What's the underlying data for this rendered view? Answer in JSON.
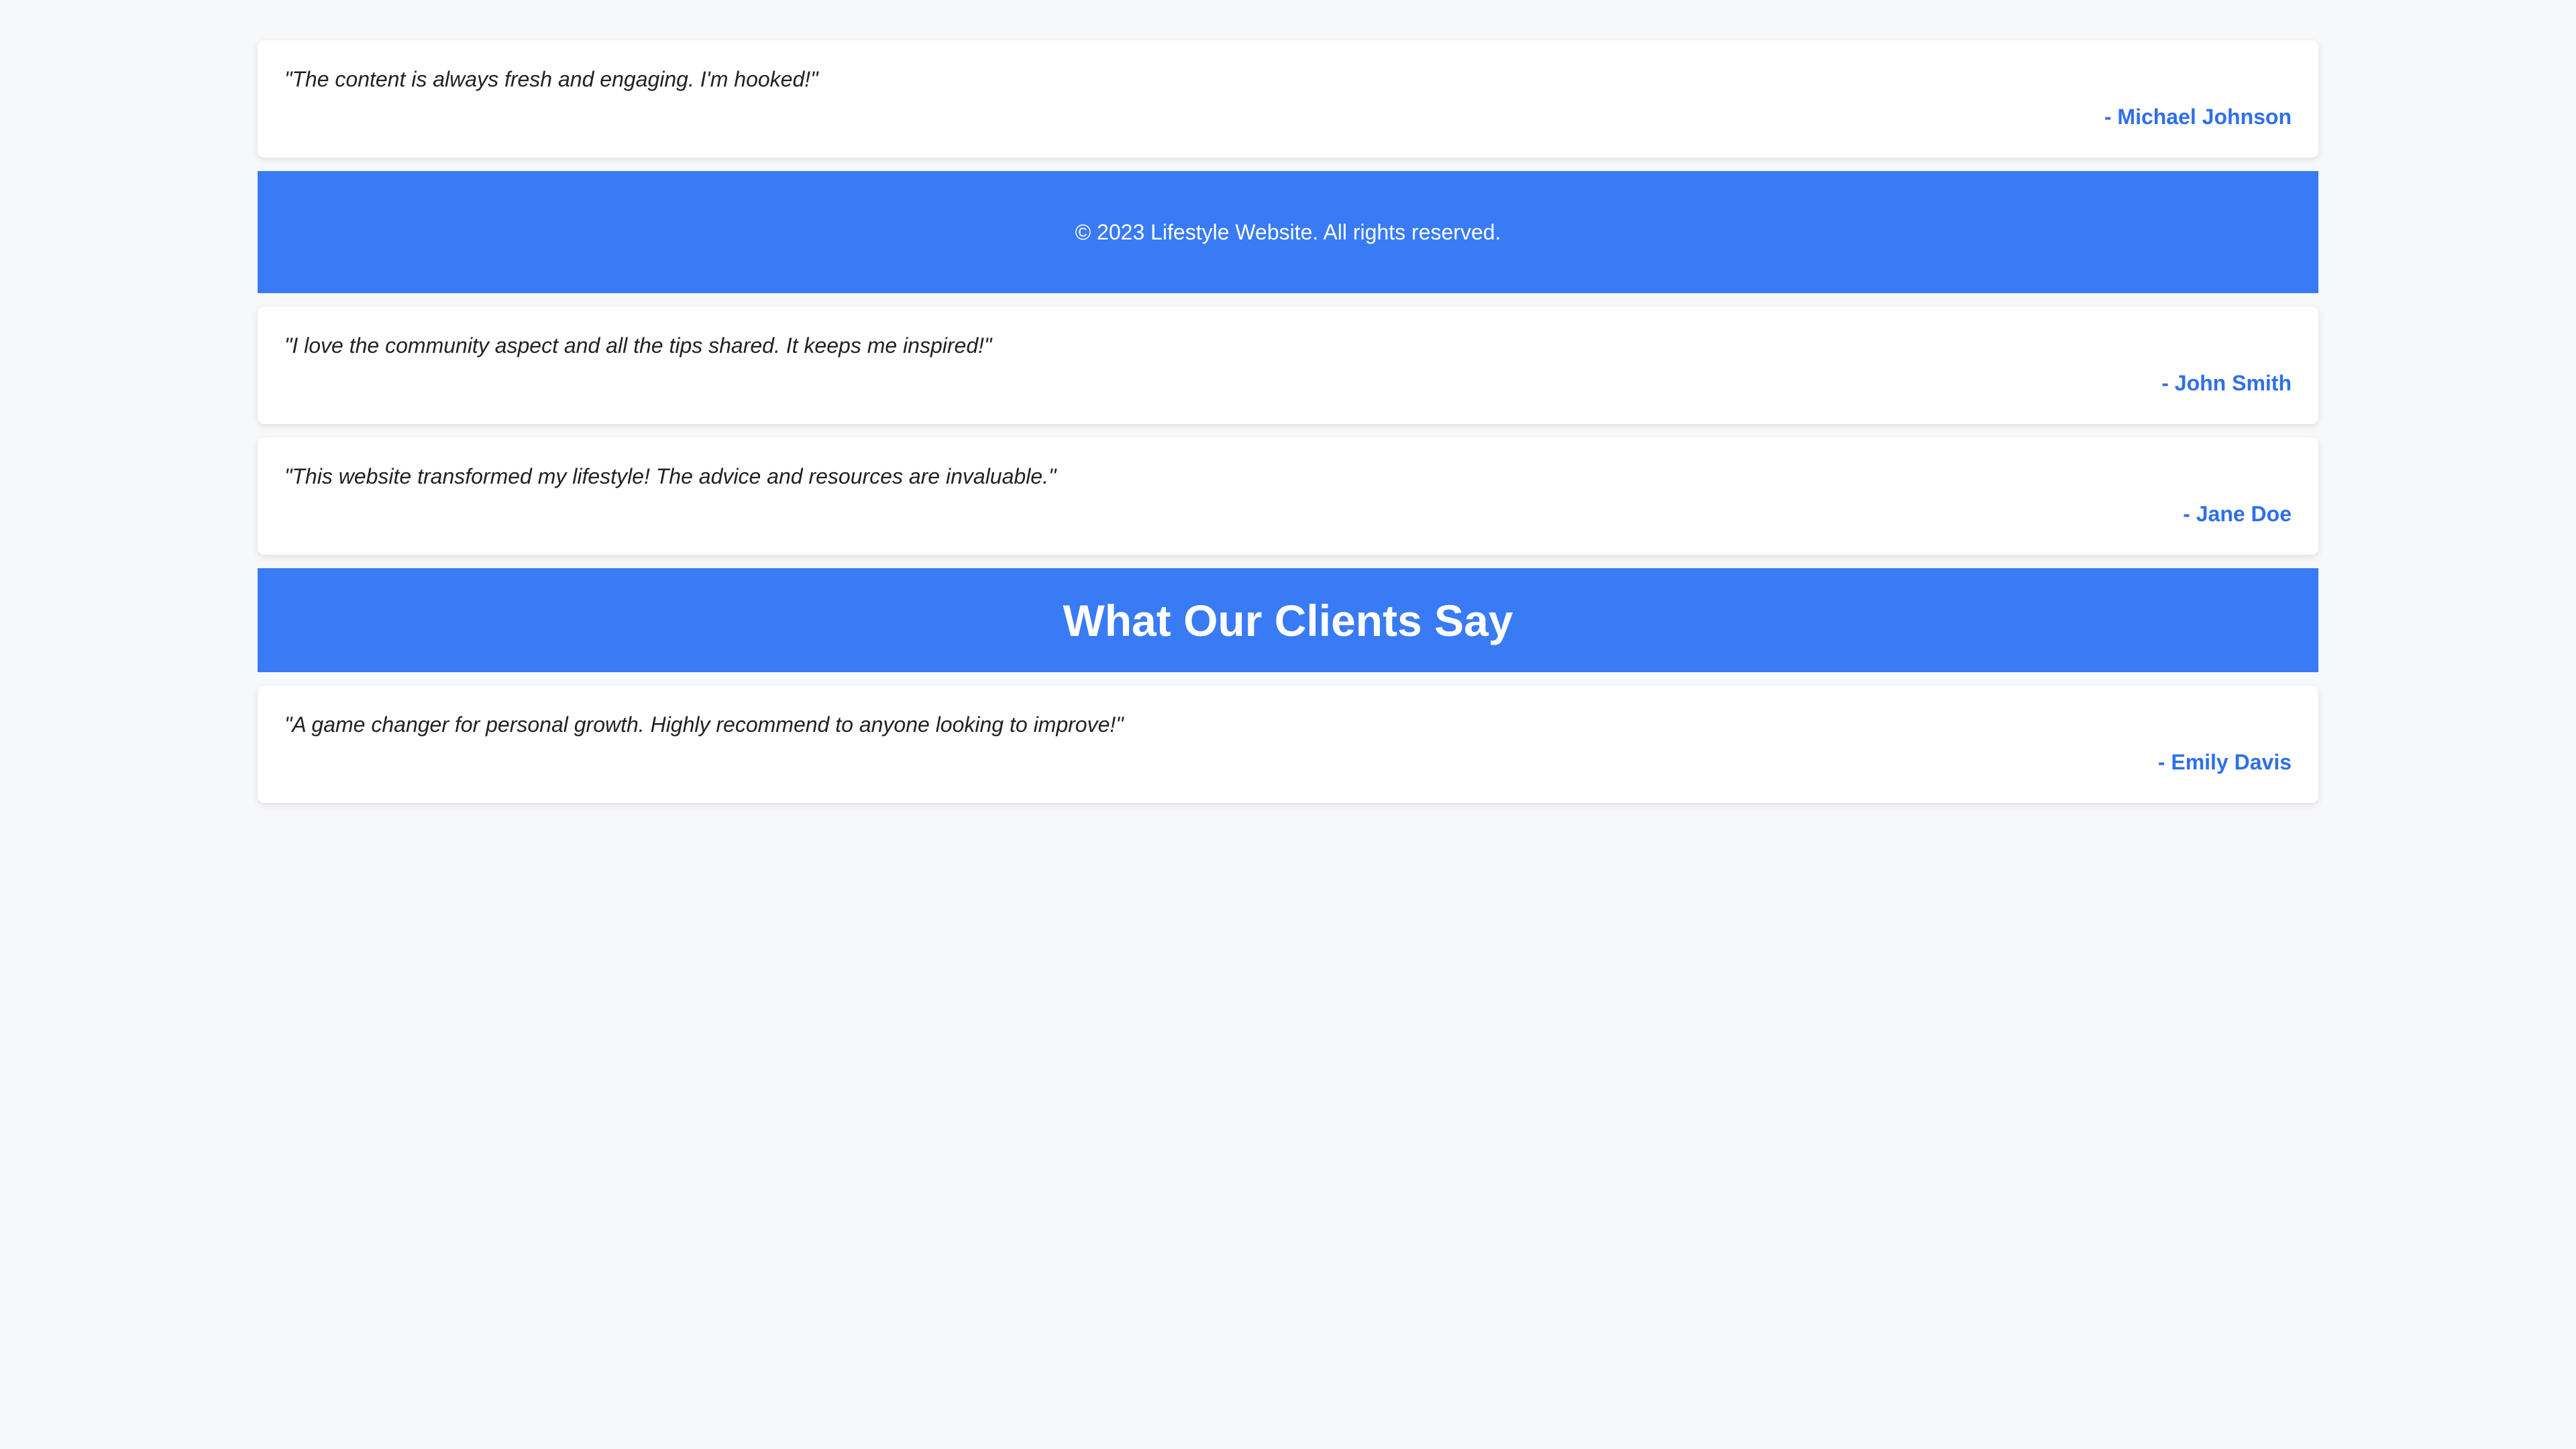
{
  "testimonials_top": [
    {
      "quote": "\"The content is always fresh and engaging. I'm hooked!\"",
      "author": "- Michael Johnson"
    }
  ],
  "footer": {
    "copyright": "© 2023 Lifestyle Website. All rights reserved."
  },
  "testimonials_middle": [
    {
      "quote": "\"I love the community aspect and all the tips shared. It keeps me inspired!\"",
      "author": "- John Smith"
    },
    {
      "quote": "\"This website transformed my lifestyle! The advice and resources are invaluable.\"",
      "author": "- Jane Doe"
    }
  ],
  "section": {
    "title": "What Our Clients Say"
  },
  "testimonials_bottom": [
    {
      "quote": "\"A game changer for personal growth. Highly recommend to anyone looking to improve!\"",
      "author": "- Emily Davis"
    }
  ],
  "colors": {
    "accent": "#387bf5",
    "author_text": "#2f6fea",
    "background": "#f7f8fa"
  }
}
